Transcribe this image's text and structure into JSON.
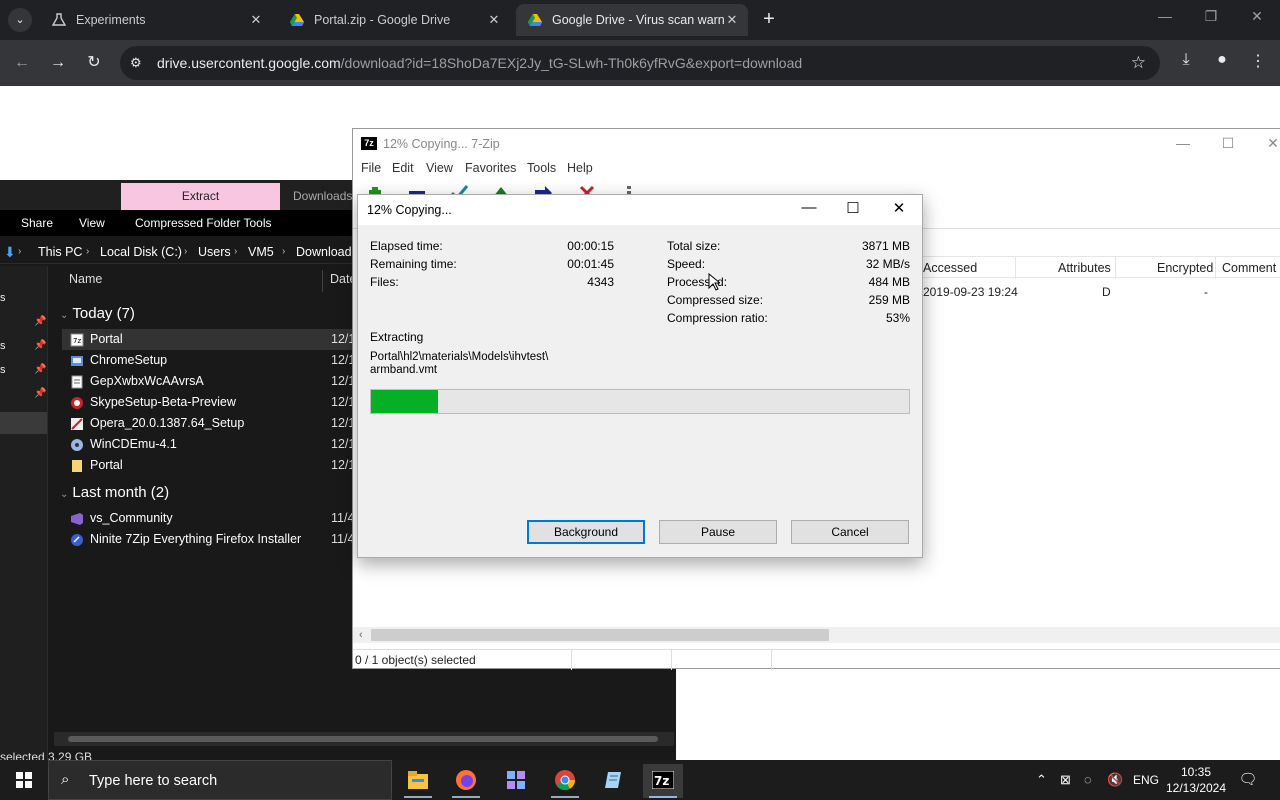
{
  "browser": {
    "tabs": [
      {
        "title": "Experiments"
      },
      {
        "title": "Portal.zip - Google Drive"
      },
      {
        "title": "Google Drive - Virus scan warn"
      }
    ],
    "url_host": "drive.usercontent.google.com",
    "url_path": "/download?id=18ShoDa7EXj2Jy_tG-SLwh-Th0k6yfRvG&export=download"
  },
  "explorer": {
    "ribbon_tab_extract": "Extract",
    "ribbon_tab_downloads": "Downloads",
    "ribbon_share": "Share",
    "ribbon_view": "View",
    "ribbon_compressed": "Compressed Folder Tools",
    "breadcrumb": [
      "This PC",
      "Local Disk (C:)",
      "Users",
      "VM5",
      "Downloads"
    ],
    "col_name": "Name",
    "col_date": "Date",
    "nav_stubs": [
      "s",
      "s",
      "s"
    ],
    "group_today": "Today (7)",
    "group_last_month": "Last month (2)",
    "today_files": [
      {
        "name": "Portal",
        "date": "12/1"
      },
      {
        "name": "ChromeSetup",
        "date": "12/1"
      },
      {
        "name": "GepXwbxWcAAvrsA",
        "date": "12/1"
      },
      {
        "name": "SkypeSetup-Beta-Preview",
        "date": "12/1"
      },
      {
        "name": "Opera_20.0.1387.64_Setup",
        "date": "12/1"
      },
      {
        "name": "WinCDEmu-4.1",
        "date": "12/1"
      },
      {
        "name": "Portal",
        "date": "12/1"
      }
    ],
    "last_month_files": [
      {
        "name": "vs_Community",
        "date": "11/4"
      },
      {
        "name": "Ninite 7Zip Everything Firefox Installer",
        "date": "11/4"
      }
    ],
    "status": "selected  3.29 GB"
  },
  "zip": {
    "title": "12% Copying... 7-Zip",
    "menu": [
      "File",
      "Edit",
      "View",
      "Favorites",
      "Tools",
      "Help"
    ],
    "columns": [
      "Accessed",
      "Attributes",
      "Encrypted",
      "Comment"
    ],
    "row": {
      "accessed": "2019-09-23 19:24",
      "attributes": "D",
      "encrypted": "-"
    },
    "status": "0 / 1 object(s) selected"
  },
  "dialog": {
    "title": "12% Copying...",
    "elapsed_label": "Elapsed time:",
    "elapsed_value": "00:00:15",
    "remaining_label": "Remaining time:",
    "remaining_value": "00:01:45",
    "files_label": "Files:",
    "files_value": "4343",
    "total_label": "Total size:",
    "total_value": "3871 MB",
    "speed_label": "Speed:",
    "speed_value": "32 MB/s",
    "processed_label": "Processed:",
    "processed_value": "484 MB",
    "compressed_label": "Compressed size:",
    "compressed_value": "259 MB",
    "ratio_label": "Compression ratio:",
    "ratio_value": "53%",
    "action": "Extracting",
    "path_line1": "Portal\\hl2\\materials\\Models\\ihvtest\\",
    "path_line2": "armband.vmt",
    "progress_percent": 12.5,
    "btn_background": "Background",
    "btn_pause": "Pause",
    "btn_cancel": "Cancel"
  },
  "taskbar": {
    "search_placeholder": "Type here to search",
    "lang": "ENG",
    "time": "10:35",
    "date": "12/13/2024"
  },
  "colors": {
    "progress_fill": "#06b025",
    "extract_tab": "#f8c6e0"
  }
}
